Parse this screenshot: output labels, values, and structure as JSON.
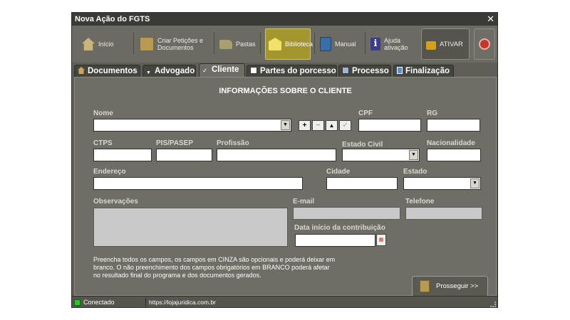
{
  "window": {
    "title": "Nova Ação do FGTS",
    "close_glyph": "✕"
  },
  "toolbar": {
    "buttons": [
      {
        "label": "Início",
        "icon": "home-icon",
        "color": "#c9b57a"
      },
      {
        "label": "Criar Petições e Documentos",
        "icon": "document-icon",
        "color": "#b89a55"
      },
      {
        "label": "Pastas",
        "icon": "folder-icon",
        "color": "#a8a070"
      },
      {
        "label": "Biblioteca",
        "icon": "library-icon",
        "color": "#e8d458"
      },
      {
        "label": "Manual",
        "icon": "book-icon",
        "color": "#3a6ea8"
      },
      {
        "label": "Ajuda ativação",
        "icon": "info-icon",
        "color": "#3c3c8e"
      },
      {
        "label": "ATIVAR",
        "icon": "lock-icon",
        "color": "#d4a01a"
      }
    ],
    "power_icon": "power-icon"
  },
  "tabs": [
    {
      "label": "Documentos",
      "icon": "home-icon",
      "active": false
    },
    {
      "label": "Advogado",
      "icon": "arrow-icon",
      "active": false
    },
    {
      "label": "Cliente",
      "icon": "check-icon",
      "active": true
    },
    {
      "label": "Partes do porcesso",
      "icon": "id-card-icon",
      "active": false
    },
    {
      "label": "Processo",
      "icon": "card-icon",
      "active": false
    },
    {
      "label": "Finalização",
      "icon": "doc-icon",
      "active": false
    }
  ],
  "form": {
    "heading": "INFORMAÇÕES SOBRE O CLIENTE",
    "labels": {
      "nome": "Nome",
      "cpf": "CPF",
      "rg": "RG",
      "ctps": "CTPS",
      "pis": "PIS/PASEP",
      "profissao": "Profissão",
      "estado_civil": "Estado Civil",
      "nacionalidade": "Nacionalidade",
      "endereco": "Endereço",
      "cidade": "Cidade",
      "estado": "Estado",
      "observacoes": "Observações",
      "email": "E-mail",
      "telefone": "Telefone",
      "data_inicio": "Data início da contribuição"
    },
    "nome_tools": [
      "+",
      "−",
      "▲",
      "✓"
    ],
    "info_text": "Preencha todos os campos, os campos em CINZA são opcionais e poderá deixar em branco. O não preenchimento dos campos obrigatórios em BRANCO poderá afetar no resultado final do programa e dos documentos gerados.",
    "next_button": "Prosseguir  >>"
  },
  "status": {
    "connection": "Conectado",
    "url": "https://lojajuridica.com.br"
  }
}
